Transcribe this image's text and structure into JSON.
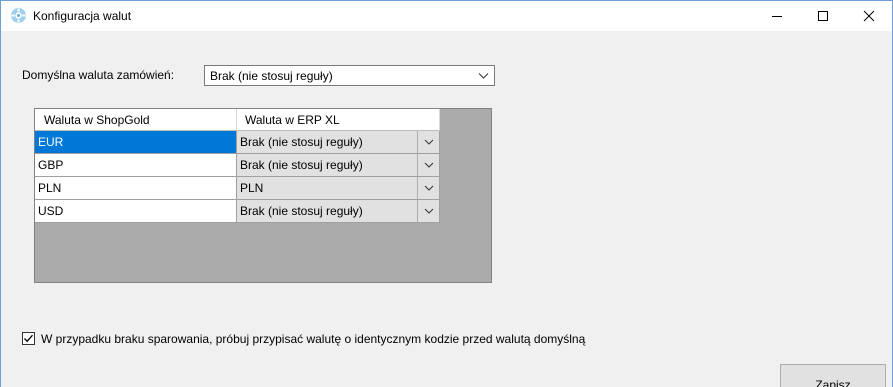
{
  "window": {
    "title": "Konfiguracja walut",
    "controls": {
      "minimize": "minimize-icon",
      "maximize": "maximize-icon",
      "close": "close-icon"
    }
  },
  "default_currency": {
    "label": "Domyślna waluta zamówień:",
    "value": "Brak (nie stosuj reguły)"
  },
  "grid": {
    "columns": [
      "Waluta w ShopGold",
      "Waluta w ERP XL"
    ],
    "rows": [
      {
        "shop": "EUR",
        "erp": "Brak (nie stosuj reguły)",
        "selected": true
      },
      {
        "shop": "GBP",
        "erp": "Brak (nie stosuj reguły)",
        "selected": false
      },
      {
        "shop": "PLN",
        "erp": "PLN",
        "selected": false
      },
      {
        "shop": "USD",
        "erp": "Brak (nie stosuj reguły)",
        "selected": false
      }
    ]
  },
  "fallback_option": {
    "checked": true,
    "label": "W przypadku braku sparowania, próbuj przypisać walutę o identycznym kodzie przed walutą domyślną"
  },
  "actions": {
    "save_label": "Zapisz"
  },
  "colors": {
    "selection": "#0078d7",
    "window_border": "#6aa1d8",
    "grid_background": "#ababab"
  }
}
